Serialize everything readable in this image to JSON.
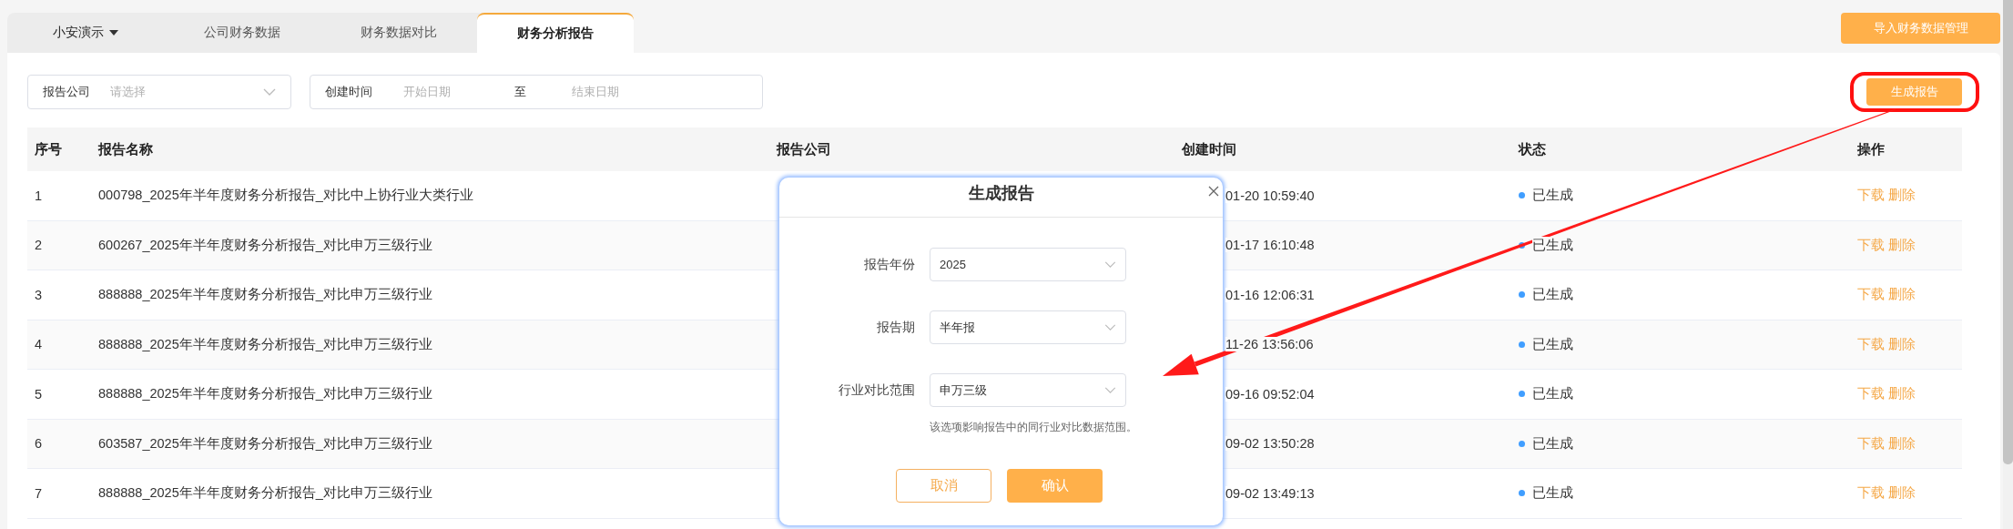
{
  "tabs": [
    {
      "label": "小安演示",
      "kind": "dropdown",
      "selected": false
    },
    {
      "label": "公司财务数据",
      "kind": "plain",
      "selected": false
    },
    {
      "label": "财务数据对比",
      "kind": "plain",
      "selected": false
    },
    {
      "label": "财务分析报告",
      "kind": "plain",
      "selected": true
    }
  ],
  "import_button": "导入财务数据管理",
  "filters": {
    "company": {
      "label": "报告公司",
      "placeholder": "请选择"
    },
    "created": {
      "label": "创建时间",
      "start_placeholder": "开始日期",
      "separator": "至",
      "end_placeholder": "结束日期"
    }
  },
  "generate_button": "生成报告",
  "table": {
    "columns": [
      "序号",
      "报告名称",
      "报告公司",
      "创建时间",
      "状态",
      "操作"
    ],
    "rows": [
      {
        "index": "1",
        "name": "000798_2025年半年度财务分析报告_对比中上协行业大类行业",
        "created": "01-20 10:59:40",
        "status": "已生成",
        "actions": [
          "下载",
          "删除"
        ]
      },
      {
        "index": "2",
        "name": "600267_2025年半年度财务分析报告_对比申万三级行业",
        "created": "01-17 16:10:48",
        "status": "已生成",
        "actions": [
          "下载",
          "删除"
        ]
      },
      {
        "index": "3",
        "name": "888888_2025年半年度财务分析报告_对比申万三级行业",
        "created": "01-16 12:06:31",
        "status": "已生成",
        "actions": [
          "下载",
          "删除"
        ]
      },
      {
        "index": "4",
        "name": "888888_2025年半年度财务分析报告_对比申万三级行业",
        "created": "11-26 13:56:06",
        "status": "已生成",
        "actions": [
          "下载",
          "删除"
        ]
      },
      {
        "index": "5",
        "name": "888888_2025年半年度财务分析报告_对比申万三级行业",
        "created": "09-16 09:52:04",
        "status": "已生成",
        "actions": [
          "下载",
          "删除"
        ]
      },
      {
        "index": "6",
        "name": "603587_2025年半年度财务分析报告_对比申万三级行业",
        "created": "09-02 13:50:28",
        "status": "已生成",
        "actions": [
          "下载",
          "删除"
        ]
      },
      {
        "index": "7",
        "name": "888888_2025年半年度财务分析报告_对比申万三级行业",
        "created": "09-02 13:49:13",
        "status": "已生成",
        "actions": [
          "下载",
          "删除"
        ]
      }
    ]
  },
  "dialog": {
    "title": "生成报告",
    "fields": [
      {
        "label": "报告年份",
        "value": "2025"
      },
      {
        "label": "报告期",
        "value": "半年报"
      },
      {
        "label": "行业对比范围",
        "value": "申万三级"
      }
    ],
    "hint": "该选项影响报告中的同行业对比数据范围。",
    "buttons": [
      {
        "label": "取消",
        "kind": "secondary"
      },
      {
        "label": "确认",
        "kind": "primary"
      }
    ]
  }
}
